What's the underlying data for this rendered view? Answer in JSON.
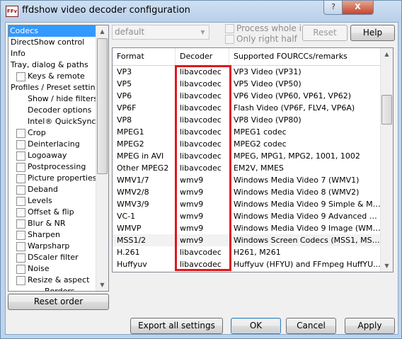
{
  "window": {
    "title": "ffdshow video decoder configuration",
    "app_icon_text": "FFv",
    "help_glyph": "?",
    "close_glyph": "X"
  },
  "tree": {
    "items": [
      {
        "label": "Codecs",
        "indent": 0,
        "checkbox": false,
        "selected": true
      },
      {
        "label": "DirectShow control",
        "indent": 0,
        "checkbox": false
      },
      {
        "label": "Info",
        "indent": 0,
        "checkbox": false
      },
      {
        "label": "Tray, dialog & paths",
        "indent": 0,
        "checkbox": false
      },
      {
        "label": "Keys & remote",
        "indent": 1,
        "checkbox": true
      },
      {
        "label": "Profiles / Preset settings",
        "indent": 0,
        "checkbox": false
      },
      {
        "label": "Show / hide filters",
        "indent": 2,
        "checkbox": false
      },
      {
        "label": "Decoder options",
        "indent": 2,
        "checkbox": false
      },
      {
        "label": "Intel® QuickSync",
        "indent": 2,
        "checkbox": false
      },
      {
        "label": "Crop",
        "indent": 1,
        "checkbox": true
      },
      {
        "label": "Deinterlacing",
        "indent": 1,
        "checkbox": true
      },
      {
        "label": "Logoaway",
        "indent": 1,
        "checkbox": true
      },
      {
        "label": "Postprocessing",
        "indent": 1,
        "checkbox": true
      },
      {
        "label": "Picture properties",
        "indent": 1,
        "checkbox": true
      },
      {
        "label": "Deband",
        "indent": 1,
        "checkbox": true
      },
      {
        "label": "Levels",
        "indent": 1,
        "checkbox": true
      },
      {
        "label": "Offset & flip",
        "indent": 1,
        "checkbox": true
      },
      {
        "label": "Blur & NR",
        "indent": 1,
        "checkbox": true
      },
      {
        "label": "Sharpen",
        "indent": 1,
        "checkbox": true
      },
      {
        "label": "Warpsharp",
        "indent": 1,
        "checkbox": true
      },
      {
        "label": "DScaler filter",
        "indent": 1,
        "checkbox": true
      },
      {
        "label": "Noise",
        "indent": 1,
        "checkbox": true
      },
      {
        "label": "Resize & aspect",
        "indent": 1,
        "checkbox": true
      },
      {
        "label": "Borders",
        "indent": 3,
        "checkbox": false
      }
    ]
  },
  "preset_combo": {
    "value": "default",
    "arrow": "▼"
  },
  "options": {
    "process_whole_image": "Process whole image",
    "only_right_half": "Only right half"
  },
  "buttons": {
    "reset": "Reset",
    "help": "Help",
    "reset_order": "Reset order",
    "export_all": "Export all settings",
    "ok": "OK",
    "cancel": "Cancel",
    "apply": "Apply"
  },
  "scroll_arrows": {
    "up": "▲",
    "down": "▼"
  },
  "table": {
    "columns": [
      "Format",
      "Decoder",
      "Supported FOURCCs/remarks"
    ],
    "rows": [
      {
        "format": "VP3",
        "decoder": "libavcodec",
        "remarks": "VP3 Video (VP31)"
      },
      {
        "format": "VP5",
        "decoder": "libavcodec",
        "remarks": "VP5 Video (VP50)"
      },
      {
        "format": "VP6",
        "decoder": "libavcodec",
        "remarks": "VP6 Video (VP60, VP61, VP62)"
      },
      {
        "format": "VP6F",
        "decoder": "libavcodec",
        "remarks": "Flash Video (VP6F, FLV4, VP6A)"
      },
      {
        "format": "VP8",
        "decoder": "libavcodec",
        "remarks": "VP8 Video (VP80)"
      },
      {
        "format": "MPEG1",
        "decoder": "libavcodec",
        "remarks": "MPEG1 codec"
      },
      {
        "format": "MPEG2",
        "decoder": "libavcodec",
        "remarks": "MPEG2 codec"
      },
      {
        "format": "MPEG in AVI",
        "decoder": "libavcodec",
        "remarks": "MPEG, MPG1, MPG2, 1001, 1002"
      },
      {
        "format": "Other MPEG2",
        "decoder": "libavcodec",
        "remarks": "EM2V, MMES"
      },
      {
        "format": "WMV1/7",
        "decoder": "wmv9",
        "remarks": "Windows Media Video 7 (WMV1)"
      },
      {
        "format": "WMV2/8",
        "decoder": "wmv9",
        "remarks": "Windows Media Video 8 (WMV2)"
      },
      {
        "format": "WMV3/9",
        "decoder": "wmv9",
        "remarks": "Windows Media Video 9 Simple & Mai..."
      },
      {
        "format": "VC-1",
        "decoder": "wmv9",
        "remarks": "Windows Media Video 9 Advanced Pr..."
      },
      {
        "format": "WMVP",
        "decoder": "wmv9",
        "remarks": "Windows Media Video 9 Image (WMV..."
      },
      {
        "format": "MSS1/2",
        "decoder": "wmv9",
        "remarks": "Windows Screen Codecs (MSS1, MSS2)",
        "highlighted": true
      },
      {
        "format": "H.261",
        "decoder": "libavcodec",
        "remarks": "H261, M261"
      },
      {
        "format": "Huffyuv",
        "decoder": "libavcodec",
        "remarks": "Huffyuv (HFYU) and FFmpeg HuffYU..."
      }
    ]
  }
}
